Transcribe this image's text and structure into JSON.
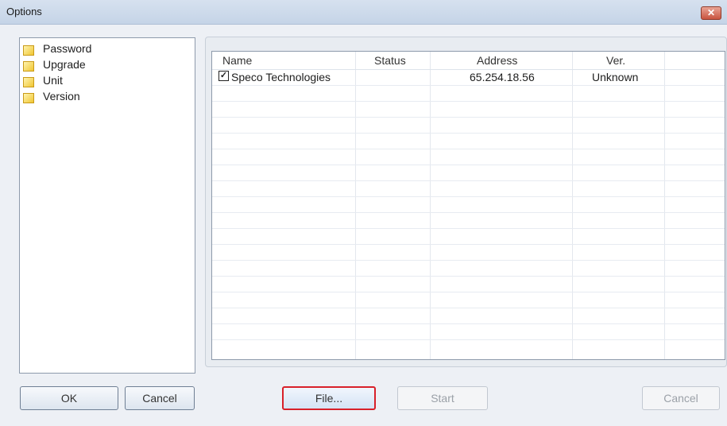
{
  "window": {
    "title": "Options",
    "close_glyph": "✕"
  },
  "tree": {
    "items": [
      {
        "label": "Password",
        "icon": "folder-icon"
      },
      {
        "label": "Upgrade",
        "icon": "folder-icon"
      },
      {
        "label": "Unit",
        "icon": "folder-icon"
      },
      {
        "label": "Version",
        "icon": "folder-icon"
      }
    ]
  },
  "table": {
    "columns": [
      "Name",
      "Status",
      "Address",
      "Ver."
    ],
    "rows": [
      {
        "checked": true,
        "check_glyph": "✓",
        "name": "Speco Technologies",
        "status": "",
        "address": "65.254.18.56",
        "ver": "Unknown"
      }
    ]
  },
  "buttons": {
    "ok": "OK",
    "cancel": "Cancel",
    "file": "File...",
    "start": "Start",
    "cancel2": "Cancel"
  },
  "colors": {
    "highlight_border": "#d8202a"
  }
}
